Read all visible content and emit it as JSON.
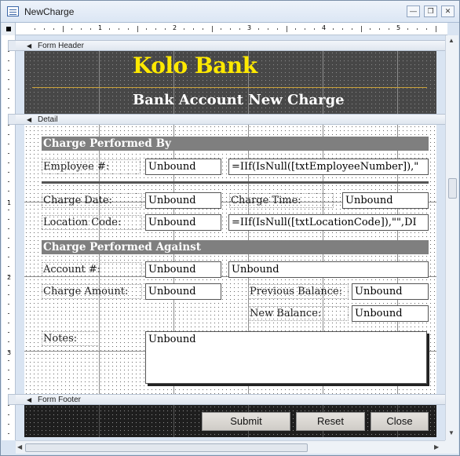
{
  "window": {
    "title": "NewCharge"
  },
  "ruler": {
    "marks": [
      "1",
      "2",
      "3",
      "4",
      "5"
    ],
    "vmarks": [
      "1",
      "2",
      "3"
    ]
  },
  "sections": {
    "header_label": "Form Header",
    "detail_label": "Detail",
    "footer_label": "Form Footer"
  },
  "header": {
    "bank_name": "Kolo Bank",
    "subtitle": "Bank Account New Charge"
  },
  "detail": {
    "group1_title": "Charge Performed By",
    "employee_label": "Employee #:",
    "employee_value": "Unbound",
    "employee_expr": "=IIf(IsNull([txtEmployeeNumber]),\"",
    "charge_date_label": "Charge Date:",
    "charge_date_value": "Unbound",
    "charge_time_label": "Charge Time:",
    "charge_time_value": "Unbound",
    "location_label": "Location Code:",
    "location_value": "Unbound",
    "location_expr": "=IIf(IsNull([txtLocationCode]),\"\",DI",
    "group2_title": "Charge Performed Against",
    "account_label": "Account #:",
    "account_value": "Unbound",
    "account_name_value": "Unbound",
    "amount_label": "Charge Amount:",
    "amount_value": "Unbound",
    "prev_balance_label": "Previous Balance:",
    "prev_balance_value": "Unbound",
    "new_balance_label": "New Balance:",
    "new_balance_value": "Unbound",
    "notes_label": "Notes:",
    "notes_value": "Unbound"
  },
  "footer": {
    "submit": "Submit",
    "reset": "Reset",
    "close": "Close"
  },
  "colors": {
    "header_bg": "#474747",
    "title_yellow": "#ffe900",
    "section_gray": "#7f7f7f"
  },
  "icons": [
    "form-app-icon",
    "minimize-icon",
    "restore-icon",
    "close-icon",
    "section-collapse-icon",
    "scroll-up-icon",
    "scroll-down-icon",
    "scroll-left-icon",
    "scroll-right-icon"
  ]
}
